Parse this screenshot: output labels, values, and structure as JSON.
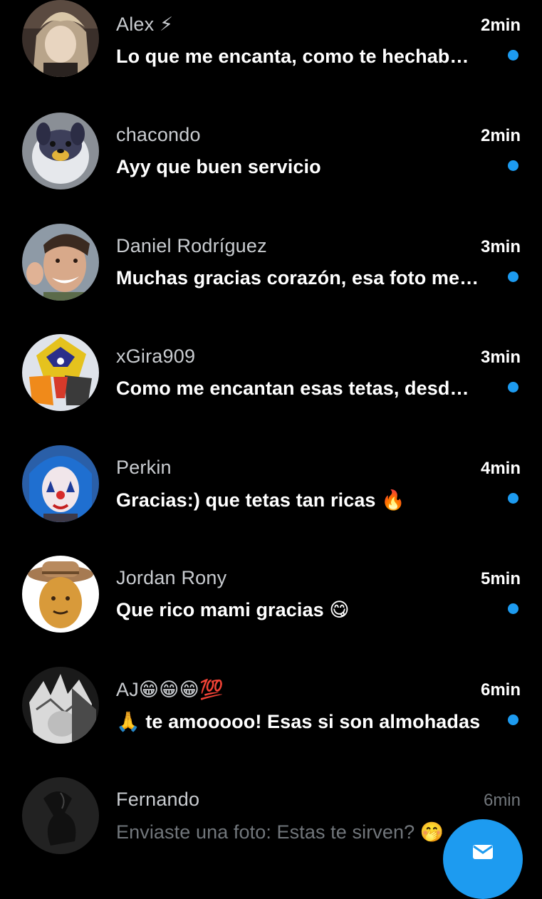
{
  "conversations": [
    {
      "name": "Alex ⚡",
      "time": "2min",
      "message": "Lo que me encanta, como te hechab…",
      "unread": true,
      "avatar_icon": "avatar-anime-character"
    },
    {
      "name": "chacondo",
      "time": "2min",
      "message": "Ayy que buen servicio",
      "unread": true,
      "avatar_icon": "avatar-cartoon-dog"
    },
    {
      "name": "Daniel Rodríguez",
      "time": "3min",
      "message": "Muchas gracias corazón, esa foto me…",
      "unread": true,
      "avatar_icon": "avatar-man-smiling"
    },
    {
      "name": "xGira909",
      "time": "3min",
      "message": "Como me encantan esas tetas, desd…",
      "unread": true,
      "avatar_icon": "avatar-yellow-robot"
    },
    {
      "name": "Perkin",
      "time": "4min",
      "message": "Gracias:) que tetas tan ricas 🔥",
      "unread": true,
      "avatar_icon": "avatar-clown-face"
    },
    {
      "name": "Jordan Rony",
      "time": "5min",
      "message": "Que rico mami gracias 😋",
      "unread": true,
      "avatar_icon": "avatar-cowboy-nugget"
    },
    {
      "name": "AJ😁😁😁💯",
      "time": "6min",
      "message": "🙏 te amooooo! Esas si son almohadas",
      "unread": true,
      "avatar_icon": "avatar-sketch-character"
    },
    {
      "name": "Fernando",
      "time": "6min",
      "message": "Enviaste una foto: Estas te sirven? 🤭",
      "unread": false,
      "avatar_icon": "avatar-dark-silhouette"
    }
  ],
  "fab": {
    "icon": "new-message-envelope-icon"
  },
  "colors": {
    "background": "#000000",
    "accent": "#1d9bf0",
    "primary_text": "#ffffff",
    "muted_text": "#71767b",
    "name_text": "#c9ccd0"
  }
}
